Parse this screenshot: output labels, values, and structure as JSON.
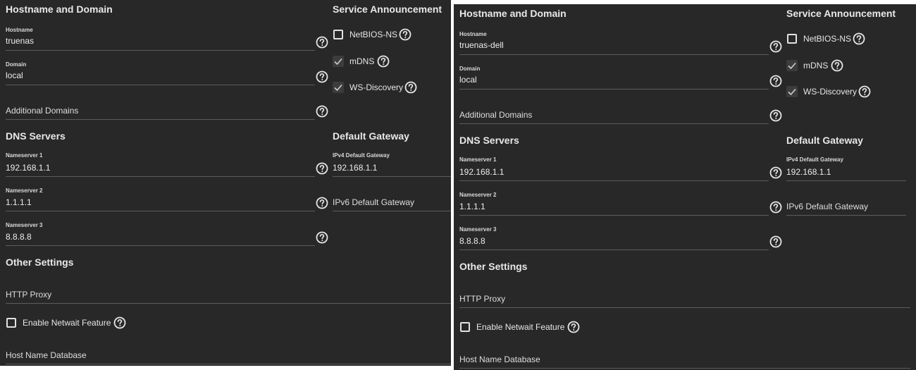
{
  "panels": [
    {
      "id": "left",
      "hostname_section": {
        "title": "Hostname and Domain",
        "hostname": {
          "label": "Hostname",
          "value": "truenas"
        },
        "domain": {
          "label": "Domain",
          "value": "local"
        },
        "additional_domains": {
          "placeholder": "Additional Domains"
        }
      },
      "service_section": {
        "title": "Service Announcement",
        "items": [
          {
            "label": "NetBIOS-NS",
            "checked": false
          },
          {
            "label": "mDNS",
            "checked": true
          },
          {
            "label": "WS-Discovery",
            "checked": true
          }
        ]
      },
      "dns_section": {
        "title": "DNS Servers",
        "ns1": {
          "label": "Nameserver 1",
          "value": "192.168.1.1"
        },
        "ns2": {
          "label": "Nameserver 2",
          "value": "1.1.1.1"
        },
        "ns3": {
          "label": "Nameserver 3",
          "value": "8.8.8.8"
        }
      },
      "gateway_section": {
        "title": "Default Gateway",
        "ipv4": {
          "label": "IPv4 Default Gateway",
          "value": "192.168.1.1"
        },
        "ipv6": {
          "placeholder": "IPv6 Default Gateway"
        }
      },
      "other_section": {
        "title": "Other Settings",
        "http_proxy": {
          "placeholder": "HTTP Proxy"
        },
        "netwait": {
          "label": "Enable Netwait Feature",
          "checked": false
        },
        "hostname_db": {
          "placeholder": "Host Name Database"
        }
      }
    },
    {
      "id": "right",
      "hostname_section": {
        "title": "Hostname and Domain",
        "hostname": {
          "label": "Hostname",
          "value": "truenas-dell"
        },
        "domain": {
          "label": "Domain",
          "value": "local"
        },
        "additional_domains": {
          "placeholder": "Additional Domains"
        }
      },
      "service_section": {
        "title": "Service Announcement",
        "items": [
          {
            "label": "NetBIOS-NS",
            "checked": false
          },
          {
            "label": "mDNS",
            "checked": true
          },
          {
            "label": "WS-Discovery",
            "checked": true
          }
        ]
      },
      "dns_section": {
        "title": "DNS Servers",
        "ns1": {
          "label": "Nameserver 1",
          "value": "192.168.1.1"
        },
        "ns2": {
          "label": "Nameserver 2",
          "value": "1.1.1.1"
        },
        "ns3": {
          "label": "Nameserver 3",
          "value": "8.8.8.8"
        }
      },
      "gateway_section": {
        "title": "Default Gateway",
        "ipv4": {
          "label": "IPv4 Default Gateway",
          "value": "192.168.1.1"
        },
        "ipv6": {
          "placeholder": "IPv6 Default Gateway"
        }
      },
      "other_section": {
        "title": "Other Settings",
        "http_proxy": {
          "placeholder": "HTTP Proxy"
        },
        "netwait": {
          "label": "Enable Netwait Feature",
          "checked": false
        },
        "hostname_db": {
          "placeholder": "Host Name Database"
        }
      }
    }
  ],
  "icons": {
    "help": "help-circle-icon",
    "check": "checkmark-icon"
  },
  "colors": {
    "background": "#282828",
    "divider": "#5c5c5c",
    "text": "#e6e6e6"
  }
}
